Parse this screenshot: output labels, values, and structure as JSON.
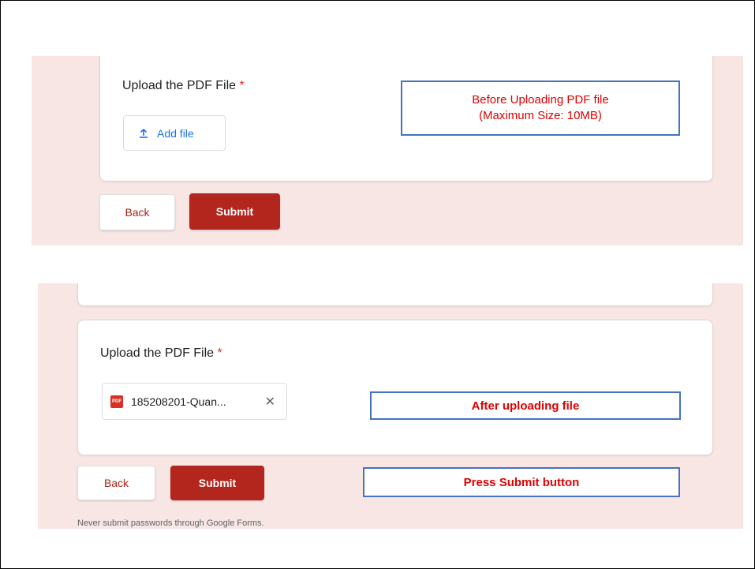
{
  "top": {
    "question_label": "Upload the PDF File",
    "required_mark": "*",
    "add_file_label": "Add file",
    "back_label": "Back",
    "submit_label": "Submit",
    "annotation_line1": "Before Uploading PDF file",
    "annotation_line2": "(Maximum Size: 10MB)"
  },
  "bottom": {
    "question_label": "Upload the PDF File",
    "required_mark": "*",
    "file_icon_text": "PDF",
    "file_name": "185208201-Quan...",
    "remove_glyph": "✕",
    "back_label": "Back",
    "submit_label": "Submit",
    "annotation_after_upload": "After uploading  file",
    "annotation_press_submit": "Press Submit button",
    "footer_text": "Never submit passwords through Google Forms."
  }
}
